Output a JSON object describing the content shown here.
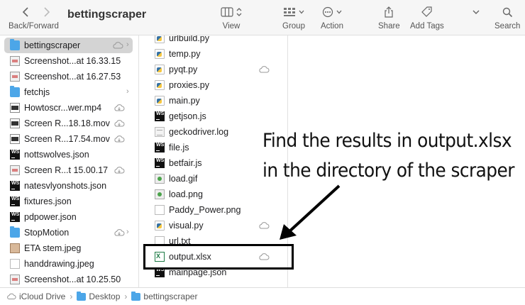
{
  "toolbar": {
    "title": "bettingscraper",
    "nav_label": "Back/Forward",
    "view_label": "View",
    "group_label": "Group",
    "action_label": "Action",
    "share_label": "Share",
    "addtags_label": "Add Tags",
    "search_label": "Search"
  },
  "left_column": {
    "items": [
      {
        "label": "bettingscraper",
        "icon": "folder-icon"
      },
      {
        "label": "Screenshot...at 16.33.15",
        "icon": "screenshot-icon"
      },
      {
        "label": "Screenshot...at 16.27.53",
        "icon": "screenshot-icon"
      },
      {
        "label": "fetchjs",
        "icon": "folder-icon"
      },
      {
        "label": "Howtoscr...wer.mp4",
        "icon": "video-icon"
      },
      {
        "label": "Screen R...18.18.mov",
        "icon": "video-icon"
      },
      {
        "label": "Screen R...17.54.mov",
        "icon": "video-icon"
      },
      {
        "label": "nottswolves.json",
        "icon": "json-icon"
      },
      {
        "label": "Screen R...t 15.00.17",
        "icon": "screenshot-icon"
      },
      {
        "label": "natesvlyonshots.json",
        "icon": "json-icon"
      },
      {
        "label": "fixtures.json",
        "icon": "json-icon"
      },
      {
        "label": "pdpower.json",
        "icon": "json-icon"
      },
      {
        "label": "StopMotion",
        "icon": "folder-icon"
      },
      {
        "label": "ETA stem.jpeg",
        "icon": "jpeg-icon"
      },
      {
        "label": "handdrawing.jpeg",
        "icon": "jpeg-icon"
      },
      {
        "label": "Screenshot...at 10.25.50",
        "icon": "screenshot-icon"
      }
    ]
  },
  "middle_column": {
    "items": [
      {
        "label": "urlbuild.py",
        "icon": "python-icon"
      },
      {
        "label": "temp.py",
        "icon": "python-icon"
      },
      {
        "label": "pyqt.py",
        "icon": "python-icon"
      },
      {
        "label": "proxies.py",
        "icon": "python-icon"
      },
      {
        "label": "main.py",
        "icon": "python-icon"
      },
      {
        "label": "getjson.js",
        "icon": "webstorm-icon"
      },
      {
        "label": "geckodriver.log",
        "icon": "log-icon"
      },
      {
        "label": "file.js",
        "icon": "webstorm-icon"
      },
      {
        "label": "betfair.js",
        "icon": "webstorm-icon"
      },
      {
        "label": "load.gif",
        "icon": "image-icon"
      },
      {
        "label": "load.png",
        "icon": "image-icon"
      },
      {
        "label": "Paddy_Power.png",
        "icon": "image-icon"
      },
      {
        "label": "visual.py",
        "icon": "python-icon"
      },
      {
        "label": "url.txt",
        "icon": "text-icon"
      },
      {
        "label": "output.xlsx",
        "icon": "excel-icon"
      },
      {
        "label": "mainpage.json",
        "icon": "json-icon"
      }
    ]
  },
  "annotation": {
    "line1": "Find the results in output.xlsx",
    "line2": "in the directory of the scraper"
  },
  "pathbar": {
    "crumbs": [
      "iCloud Drive",
      "Desktop",
      "bettingscraper"
    ]
  },
  "colors": {
    "folder": "#4ca6e8",
    "selection": "#d4d4d4",
    "excel": "#1d7a45"
  }
}
